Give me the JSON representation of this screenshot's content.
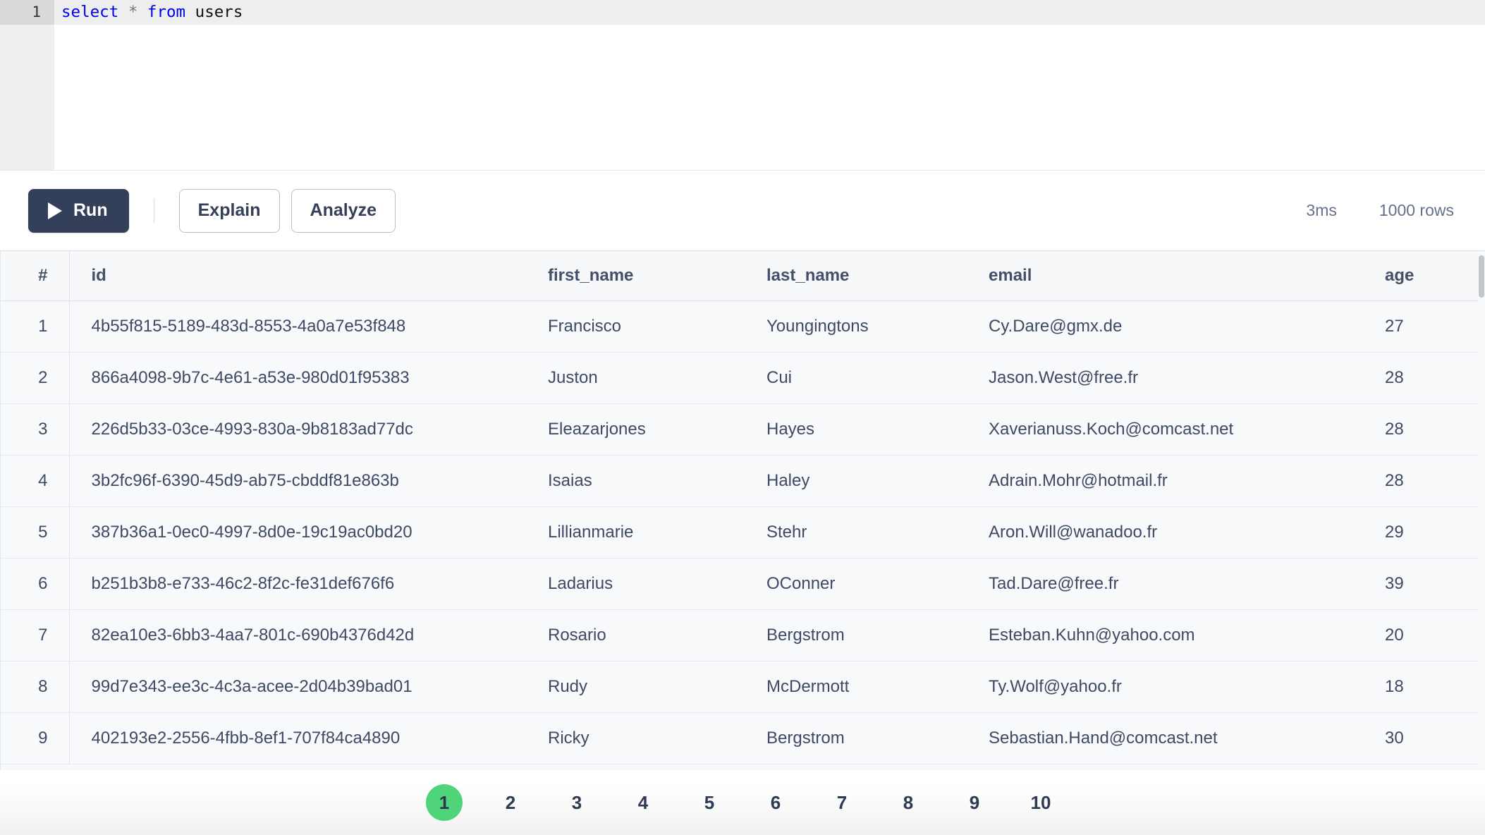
{
  "editor": {
    "line_number": "1",
    "tokens": [
      {
        "text": "select",
        "type": "keyword"
      },
      {
        "text": " ",
        "type": "plain"
      },
      {
        "text": "*",
        "type": "operator"
      },
      {
        "text": " ",
        "type": "plain"
      },
      {
        "text": "from",
        "type": "keyword"
      },
      {
        "text": " ",
        "type": "plain"
      },
      {
        "text": "users",
        "type": "identifier"
      }
    ],
    "query_text": "select * from users"
  },
  "toolbar": {
    "run_label": "Run",
    "run_icon": "play-icon",
    "explain_label": "Explain",
    "analyze_label": "Analyze",
    "duration": "3ms",
    "row_count": "1000 rows"
  },
  "results": {
    "columns": [
      "#",
      "id",
      "first_name",
      "last_name",
      "email",
      "age"
    ],
    "rows": [
      {
        "n": "1",
        "id": "4b55f815-5189-483d-8553-4a0a7e53f848",
        "first_name": "Francisco",
        "last_name": "Youngingtons",
        "email": "Cy.Dare@gmx.de",
        "age": "27"
      },
      {
        "n": "2",
        "id": "866a4098-9b7c-4e61-a53e-980d01f95383",
        "first_name": "Juston",
        "last_name": "Cui",
        "email": "Jason.West@free.fr",
        "age": "28"
      },
      {
        "n": "3",
        "id": "226d5b33-03ce-4993-830a-9b8183ad77dc",
        "first_name": "Eleazarjones",
        "last_name": "Hayes",
        "email": "Xaverianuss.Koch@comcast.net",
        "age": "28"
      },
      {
        "n": "4",
        "id": "3b2fc96f-6390-45d9-ab75-cbddf81e863b",
        "first_name": "Isaias",
        "last_name": "Haley",
        "email": "Adrain.Mohr@hotmail.fr",
        "age": "28"
      },
      {
        "n": "5",
        "id": "387b36a1-0ec0-4997-8d0e-19c19ac0bd20",
        "first_name": "Lillianmarie",
        "last_name": "Stehr",
        "email": "Aron.Will@wanadoo.fr",
        "age": "29"
      },
      {
        "n": "6",
        "id": "b251b3b8-e733-46c2-8f2c-fe31def676f6",
        "first_name": "Ladarius",
        "last_name": "OConner",
        "email": "Tad.Dare@free.fr",
        "age": "39"
      },
      {
        "n": "7",
        "id": "82ea10e3-6bb3-4aa7-801c-690b4376d42d",
        "first_name": "Rosario",
        "last_name": "Bergstrom",
        "email": "Esteban.Kuhn@yahoo.com",
        "age": "20"
      },
      {
        "n": "8",
        "id": "99d7e343-ee3c-4c3a-acee-2d04b39bad01",
        "first_name": "Rudy",
        "last_name": "McDermott",
        "email": "Ty.Wolf@yahoo.fr",
        "age": "18"
      },
      {
        "n": "9",
        "id": "402193e2-2556-4fbb-8ef1-707f84ca4890",
        "first_name": "Ricky",
        "last_name": "Bergstrom",
        "email": "Sebastian.Hand@comcast.net",
        "age": "30"
      }
    ]
  },
  "pagination": {
    "pages": [
      "1",
      "2",
      "3",
      "4",
      "5",
      "6",
      "7",
      "8",
      "9",
      "10"
    ],
    "active_page": "1",
    "active_color": "#4fd47a"
  },
  "colors": {
    "run_button_bg": "#34405a",
    "text_primary": "#3e4a63",
    "text_muted": "#64718c",
    "grid_bg": "#f8f9fb",
    "header_bg": "#f6f8fa",
    "border": "#e6e9ee",
    "keyword": "#0000ee",
    "gutter_bg": "#efefef"
  }
}
